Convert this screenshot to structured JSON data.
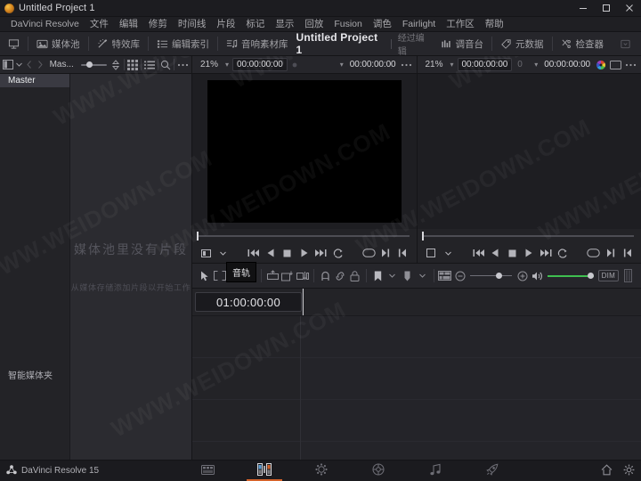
{
  "window": {
    "title": "Untitled Project 1",
    "app_icon": "resolve-logo-icon",
    "minimize": "minimize-icon",
    "maximize": "maximize-icon",
    "close": "close-icon"
  },
  "menubar": {
    "items": [
      "DaVinci Resolve",
      "文件",
      "编辑",
      "修剪",
      "时间线",
      "片段",
      "标记",
      "显示",
      "回放",
      "Fusion",
      "调色",
      "Fairlight",
      "工作区",
      "帮助"
    ]
  },
  "toolbar": {
    "home_icon": "project-manager-icon",
    "left_buttons": [
      {
        "label": "媒体池",
        "icon": "media-pool-icon"
      },
      {
        "label": "特效库",
        "icon": "effects-library-icon"
      },
      {
        "label": "编辑索引",
        "icon": "edit-index-icon"
      },
      {
        "label": "音响素材库",
        "icon": "sound-library-icon"
      }
    ],
    "project_title": "Untitled Project 1",
    "project_status": "经过编辑",
    "right_buttons": [
      {
        "label": "调音台",
        "icon": "mixer-icon"
      },
      {
        "label": "元数据",
        "icon": "metadata-icon"
      },
      {
        "label": "检查器",
        "icon": "inspector-icon"
      }
    ]
  },
  "media_pool": {
    "toolbar": {
      "sidebar_toggle_icon": "panel-toggle-icon",
      "caret_icon": "chevron-down-icon",
      "back_icon": "chevron-left-icon",
      "forward_icon": "chevron-right-icon",
      "bin_label": "Mas...",
      "thumb_slider_value": "20",
      "stepper_icon": "sort-order-icon",
      "thumbnail_view_icon": "grid-view-icon",
      "list_view_icon": "list-view-icon",
      "search_icon": "search-icon",
      "options_icon": "more-options-icon"
    },
    "bins": [
      {
        "label": "Master",
        "selected": true
      },
      {
        "label": "智能媒体夹",
        "selected": false
      }
    ],
    "empty_title": "媒体池里没有片段",
    "empty_subtitle": "从媒体存储添加片段以开始工作"
  },
  "source_viewer": {
    "zoom": "21%",
    "timecode_left": "00:00:00:00",
    "clip_name": "",
    "timecode_right": "00:00:00:00",
    "frame_icon": "viewer-mode-icon",
    "caret_icon": "chevron-down-icon",
    "options_icon": "more-options-icon",
    "transport": [
      {
        "name": "jump-to-start-button",
        "icon": "skip-back-icon"
      },
      {
        "name": "play-reverse-button",
        "icon": "play-reverse-icon"
      },
      {
        "name": "stop-button",
        "icon": "stop-icon"
      },
      {
        "name": "play-forward-button",
        "icon": "play-icon"
      },
      {
        "name": "jump-to-end-button",
        "icon": "skip-forward-icon"
      },
      {
        "name": "loop-button",
        "icon": "loop-icon"
      },
      {
        "name": "mark-clip-button",
        "icon": "mark-clip-icon"
      },
      {
        "name": "next-mark-button",
        "icon": "mark-out-icon"
      },
      {
        "name": "prev-mark-button",
        "icon": "mark-in-icon"
      }
    ]
  },
  "timeline_viewer": {
    "zoom": "21%",
    "timecode_left": "00:00:00:00",
    "clip_name": "0",
    "timecode_right": "00:00:00:00",
    "color_icon": "color-wheel-icon",
    "display_icon": "fit-screen-icon",
    "caret_icon": "chevron-down-icon",
    "options_icon": "more-options-icon"
  },
  "edit_toolbar": {
    "tooltip": "音轨",
    "tools": [
      {
        "name": "selection-tool",
        "icon": "arrow-cursor-icon"
      },
      {
        "name": "trim-edit-tool",
        "icon": "trim-icon"
      },
      {
        "name": "dynamic-trim-tool",
        "icon": "dynamic-trim-icon"
      },
      {
        "name": "razor-tool",
        "icon": "blade-icon"
      },
      {
        "name": "insert-clip-button",
        "icon": "insert-icon"
      },
      {
        "name": "overwrite-clip-button",
        "icon": "overwrite-icon"
      },
      {
        "name": "replace-clip-button",
        "icon": "replace-icon"
      },
      {
        "name": "snapping-toggle",
        "icon": "magnet-icon"
      },
      {
        "name": "linked-selection-toggle",
        "icon": "link-icon"
      },
      {
        "name": "lock-track-toggle",
        "icon": "lock-icon"
      },
      {
        "name": "flag-button",
        "icon": "flag-icon"
      },
      {
        "name": "marker-button",
        "icon": "marker-icon"
      }
    ],
    "zoom_out_icon": "zoom-out-icon",
    "zoom_in_icon": "zoom-in-icon",
    "fit_icon": "timeline-view-options-icon",
    "volume_icon": "speaker-icon",
    "dim_label": "DIM",
    "meter_icon": "audio-meter-icon"
  },
  "timeline": {
    "timecode": "01:00:00:00"
  },
  "statusbar": {
    "brand_icon": "resolve-mark-icon",
    "brand": "DaVinci Resolve 15",
    "pages": [
      {
        "name": "media-page",
        "icon": "media-page-icon",
        "active": false
      },
      {
        "name": "edit-page",
        "icon": "edit-page-icon",
        "active": true
      },
      {
        "name": "fusion-page",
        "icon": "fusion-page-icon",
        "active": false
      },
      {
        "name": "color-page",
        "icon": "color-page-icon",
        "active": false
      },
      {
        "name": "fairlight-page",
        "icon": "fairlight-page-icon",
        "active": false
      },
      {
        "name": "deliver-page",
        "icon": "deliver-page-icon",
        "active": false
      }
    ],
    "home_icon": "home-icon",
    "settings_icon": "gear-icon"
  },
  "watermarks": [
    "WWW.WEIDOWN.COM",
    "WWW.WEIDOWN.COM",
    "WWW.WEIDOWN.COM",
    "WWW.WEIDOWN.COM",
    "WWW.WEIDOWN.COM",
    "WWW.WEIDOWN.COM",
    "WWW.WEIDOWN.COM",
    "WWW.WEIDOWN.COM"
  ],
  "colors": {
    "accent": "#d4622a",
    "volume": "#3fbf50",
    "panel": "#232327",
    "toolbar": "#26262b"
  }
}
